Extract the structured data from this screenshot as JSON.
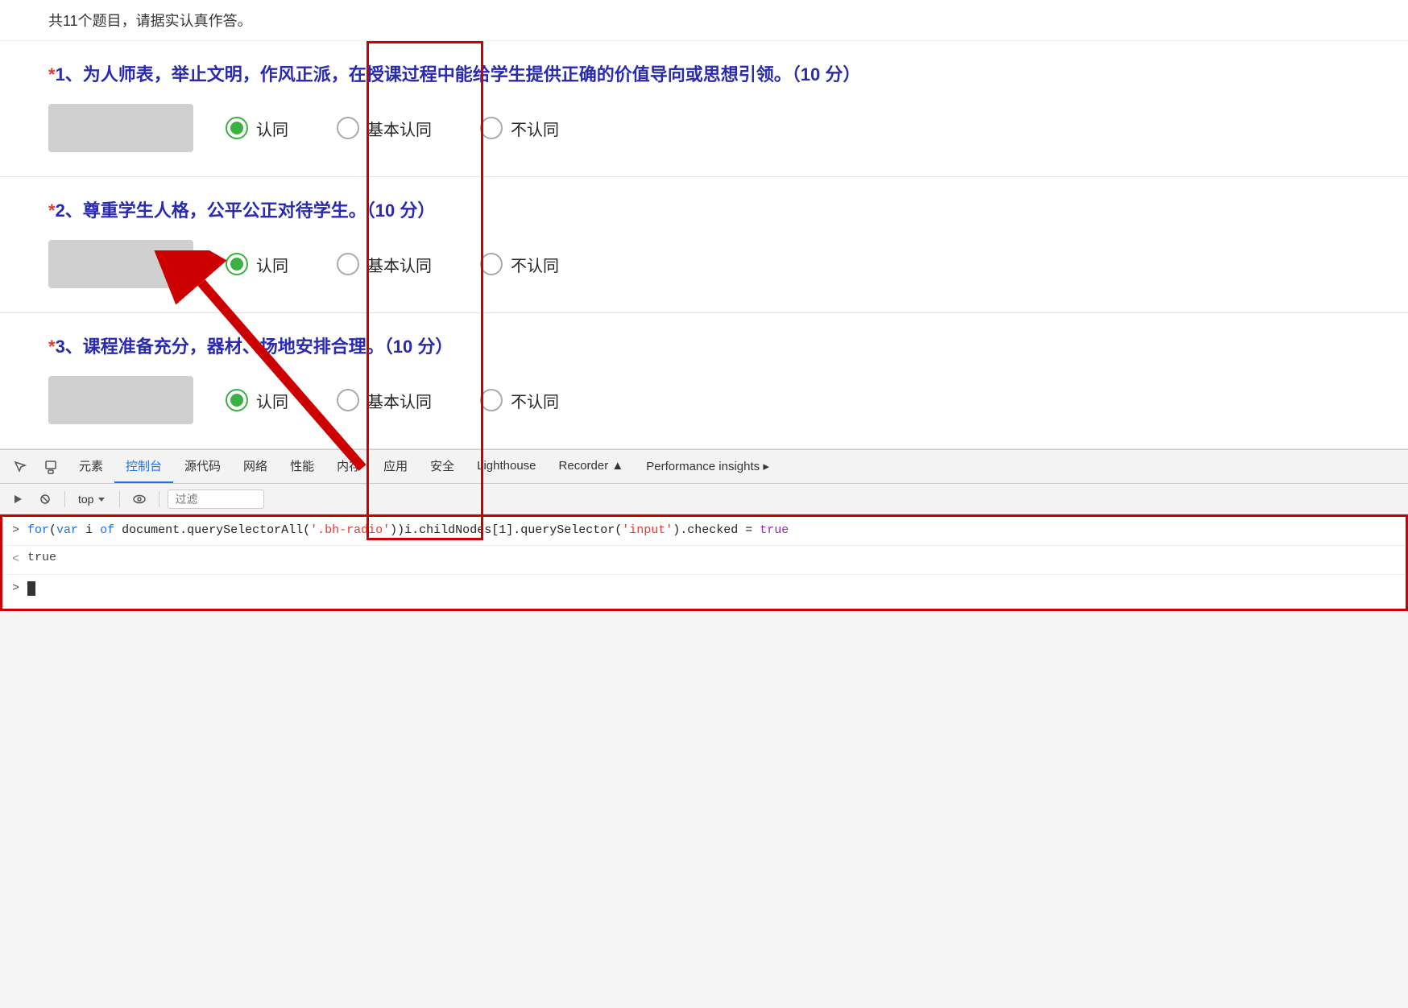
{
  "header": {
    "note": "共11个题目，请据实认真作答。"
  },
  "questions": [
    {
      "id": 1,
      "required": "*",
      "title": "1、为人师表，举止文明，作风正派，在授课过程中能给学生提供正确的价值导向或思想引领。（10 分）",
      "options": [
        {
          "label": "认同",
          "checked": true
        },
        {
          "label": "基本认同",
          "checked": false
        },
        {
          "label": "不认同",
          "checked": false
        }
      ]
    },
    {
      "id": 2,
      "required": "*",
      "title": "2、尊重学生人格，公平公正对待学生。（10 分）",
      "options": [
        {
          "label": "认同",
          "checked": true
        },
        {
          "label": "基本认同",
          "checked": false
        },
        {
          "label": "不认同",
          "checked": false
        }
      ]
    },
    {
      "id": 3,
      "required": "*",
      "title": "3、课程准备充分，器材、场地安排合理。（10 分）",
      "options": [
        {
          "label": "认同",
          "checked": true
        },
        {
          "label": "基本认同",
          "checked": false
        },
        {
          "label": "不认同",
          "checked": false
        }
      ]
    }
  ],
  "devtools": {
    "tabs": [
      "元素",
      "控制台",
      "源代码",
      "网络",
      "性能",
      "内存",
      "应用",
      "安全",
      "Lighthouse",
      "Recorder ▲",
      "Performance insights ▸"
    ],
    "active_tab": "控制台",
    "toolbar": {
      "top_label": "top",
      "filter_placeholder": "过滤"
    }
  },
  "console": {
    "input_prompt": ">",
    "output_prompt": "<",
    "code_line": "for(var i of document.querySelectorAll('.bh-radio'))i.childNodes[1].querySelector('input').checked = true",
    "result_line": "true"
  }
}
